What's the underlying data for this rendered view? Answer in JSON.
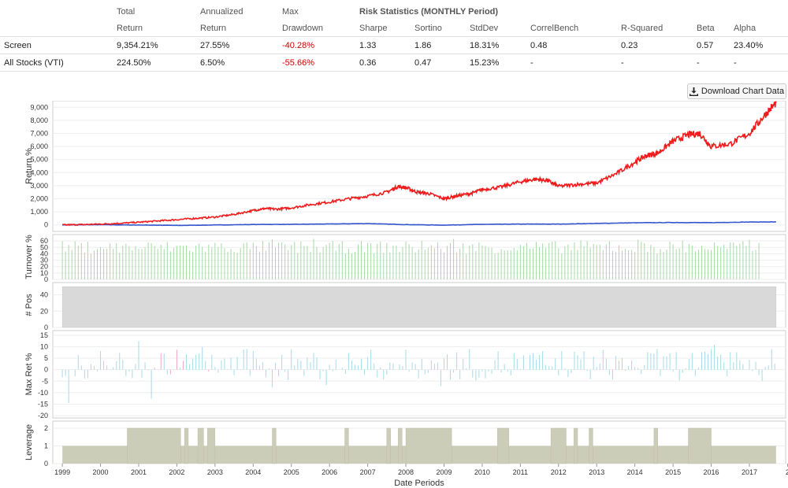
{
  "stats": {
    "header_top": [
      "Total",
      "Annualized",
      "Max",
      "Risk Statistics (MONTHLY Period)"
    ],
    "header_bottom": [
      "Return",
      "Return",
      "Drawdown",
      "Sharpe",
      "Sortino",
      "StdDev",
      "CorrelBench",
      "R-Squared",
      "Beta",
      "Alpha"
    ],
    "rows": [
      {
        "name": "Screen",
        "cells": [
          "9,354.21%",
          "27.55%",
          "-40.28%",
          "1.33",
          "1.86",
          "18.31%",
          "0.48",
          "0.23",
          "0.57",
          "23.40%"
        ]
      },
      {
        "name": "All Stocks (VTI)",
        "cells": [
          "224.50%",
          "6.50%",
          "-55.66%",
          "0.36",
          "0.47",
          "15.23%",
          "-",
          "-",
          "-",
          "-"
        ]
      }
    ]
  },
  "download_button": {
    "label": "Download Chart Data",
    "icon": "download-icon"
  },
  "colors": {
    "screen": "#ee1c1c",
    "benchmark": "#3355cc",
    "turnover": "#a8d8a8",
    "positions": "#d9d9d9",
    "pos_ret": "#a6dbe8",
    "neg_ret": "#f0a8c8",
    "leverage": "#cccdb8"
  },
  "chart_data": [
    {
      "type": "line",
      "ylabel": "Return %",
      "ylim": [
        -500,
        9500
      ],
      "yticks": [
        0,
        1000,
        2000,
        3000,
        4000,
        5000,
        6000,
        7000,
        8000,
        9000
      ],
      "yticklabels": [
        "0",
        "1,000",
        "2,000",
        "3,000",
        "4,000",
        "5,000",
        "6,000",
        "7,000",
        "8,000",
        "9,000"
      ],
      "series": [
        {
          "x": [
            1999.0,
            1999.5,
            2000.0,
            2000.5,
            2001.0,
            2001.5,
            2002.0,
            2002.5,
            2003.0,
            2003.5,
            2004.0,
            2004.3,
            2004.6,
            2005.0,
            2005.5,
            2006.0,
            2006.5,
            2007.0,
            2007.5,
            2007.8,
            2008.0,
            2008.3,
            2008.6,
            2009.0,
            2009.3,
            2009.7,
            2010.0,
            2010.5,
            2011.0,
            2011.4,
            2011.7,
            2012.0,
            2012.5,
            2013.0,
            2013.5,
            2014.0,
            2014.3,
            2014.6,
            2015.0,
            2015.4,
            2015.7,
            2016.0,
            2016.5,
            2017.0,
            2017.4,
            2017.7
          ],
          "y": [
            0,
            20,
            60,
            120,
            200,
            300,
            400,
            500,
            600,
            800,
            1100,
            1250,
            1200,
            1300,
            1550,
            1750,
            2000,
            2200,
            2500,
            2950,
            2850,
            2500,
            2400,
            2000,
            2200,
            2400,
            2700,
            2900,
            3300,
            3500,
            3400,
            2950,
            3100,
            3200,
            3900,
            4800,
            5300,
            5500,
            6400,
            6900,
            7000,
            6000,
            6200,
            7000,
            8400,
            9354
          ]
        },
        {
          "x": [
            1999.0,
            2000.0,
            2001.0,
            2002.0,
            2003.0,
            2004.0,
            2005.0,
            2006.0,
            2007.0,
            2008.0,
            2009.0,
            2010.0,
            2011.0,
            2012.0,
            2013.0,
            2014.0,
            2015.0,
            2016.0,
            2017.0,
            2017.7
          ],
          "y": [
            0,
            10,
            -10,
            -40,
            -10,
            30,
            40,
            70,
            100,
            20,
            -20,
            40,
            60,
            60,
            110,
            160,
            180,
            170,
            220,
            224.5
          ]
        }
      ]
    },
    {
      "type": "bar",
      "ylabel": "Turnover %",
      "ylim": [
        0,
        70
      ],
      "yticks": [
        0,
        10,
        20,
        30,
        40,
        50,
        60
      ],
      "typical_range": [
        40,
        65
      ]
    },
    {
      "type": "area",
      "ylabel": "# Pos",
      "ylim": [
        0,
        55
      ],
      "yticks": [
        0,
        20,
        40
      ],
      "value": 50
    },
    {
      "type": "bar",
      "ylabel": "Max Ret %",
      "ylim": [
        -21,
        17
      ],
      "yticks": [
        -20,
        -15,
        -10,
        -5,
        0,
        5,
        10,
        15
      ],
      "typical_range": [
        -20,
        15
      ]
    },
    {
      "type": "bar",
      "ylabel": "Leverage",
      "ylim": [
        0,
        2.4
      ],
      "yticks": [
        0,
        1,
        2
      ],
      "base_value": 1,
      "high_value": 2,
      "high_periods": [
        [
          2000.7,
          2002.1
        ],
        [
          2002.2,
          2002.3
        ],
        [
          2002.55,
          2002.7
        ],
        [
          2002.8,
          2003.0
        ],
        [
          2004.5,
          2004.6
        ],
        [
          2006.4,
          2006.5
        ],
        [
          2007.5,
          2007.6
        ],
        [
          2007.8,
          2007.9
        ],
        [
          2008.0,
          2009.2
        ],
        [
          2010.4,
          2010.7
        ],
        [
          2011.8,
          2012.2
        ],
        [
          2012.4,
          2012.5
        ],
        [
          2012.8,
          2012.9
        ],
        [
          2014.5,
          2014.6
        ],
        [
          2015.4,
          2016.0
        ]
      ]
    }
  ],
  "x_axis": {
    "label": "Date Periods",
    "ticks": [
      "1999",
      "2000",
      "2001",
      "2002",
      "2003",
      "2004",
      "2005",
      "2006",
      "2007",
      "2008",
      "2009",
      "2010",
      "2011",
      "2012",
      "2013",
      "2014",
      "2015",
      "2016",
      "2017",
      "2"
    ]
  }
}
